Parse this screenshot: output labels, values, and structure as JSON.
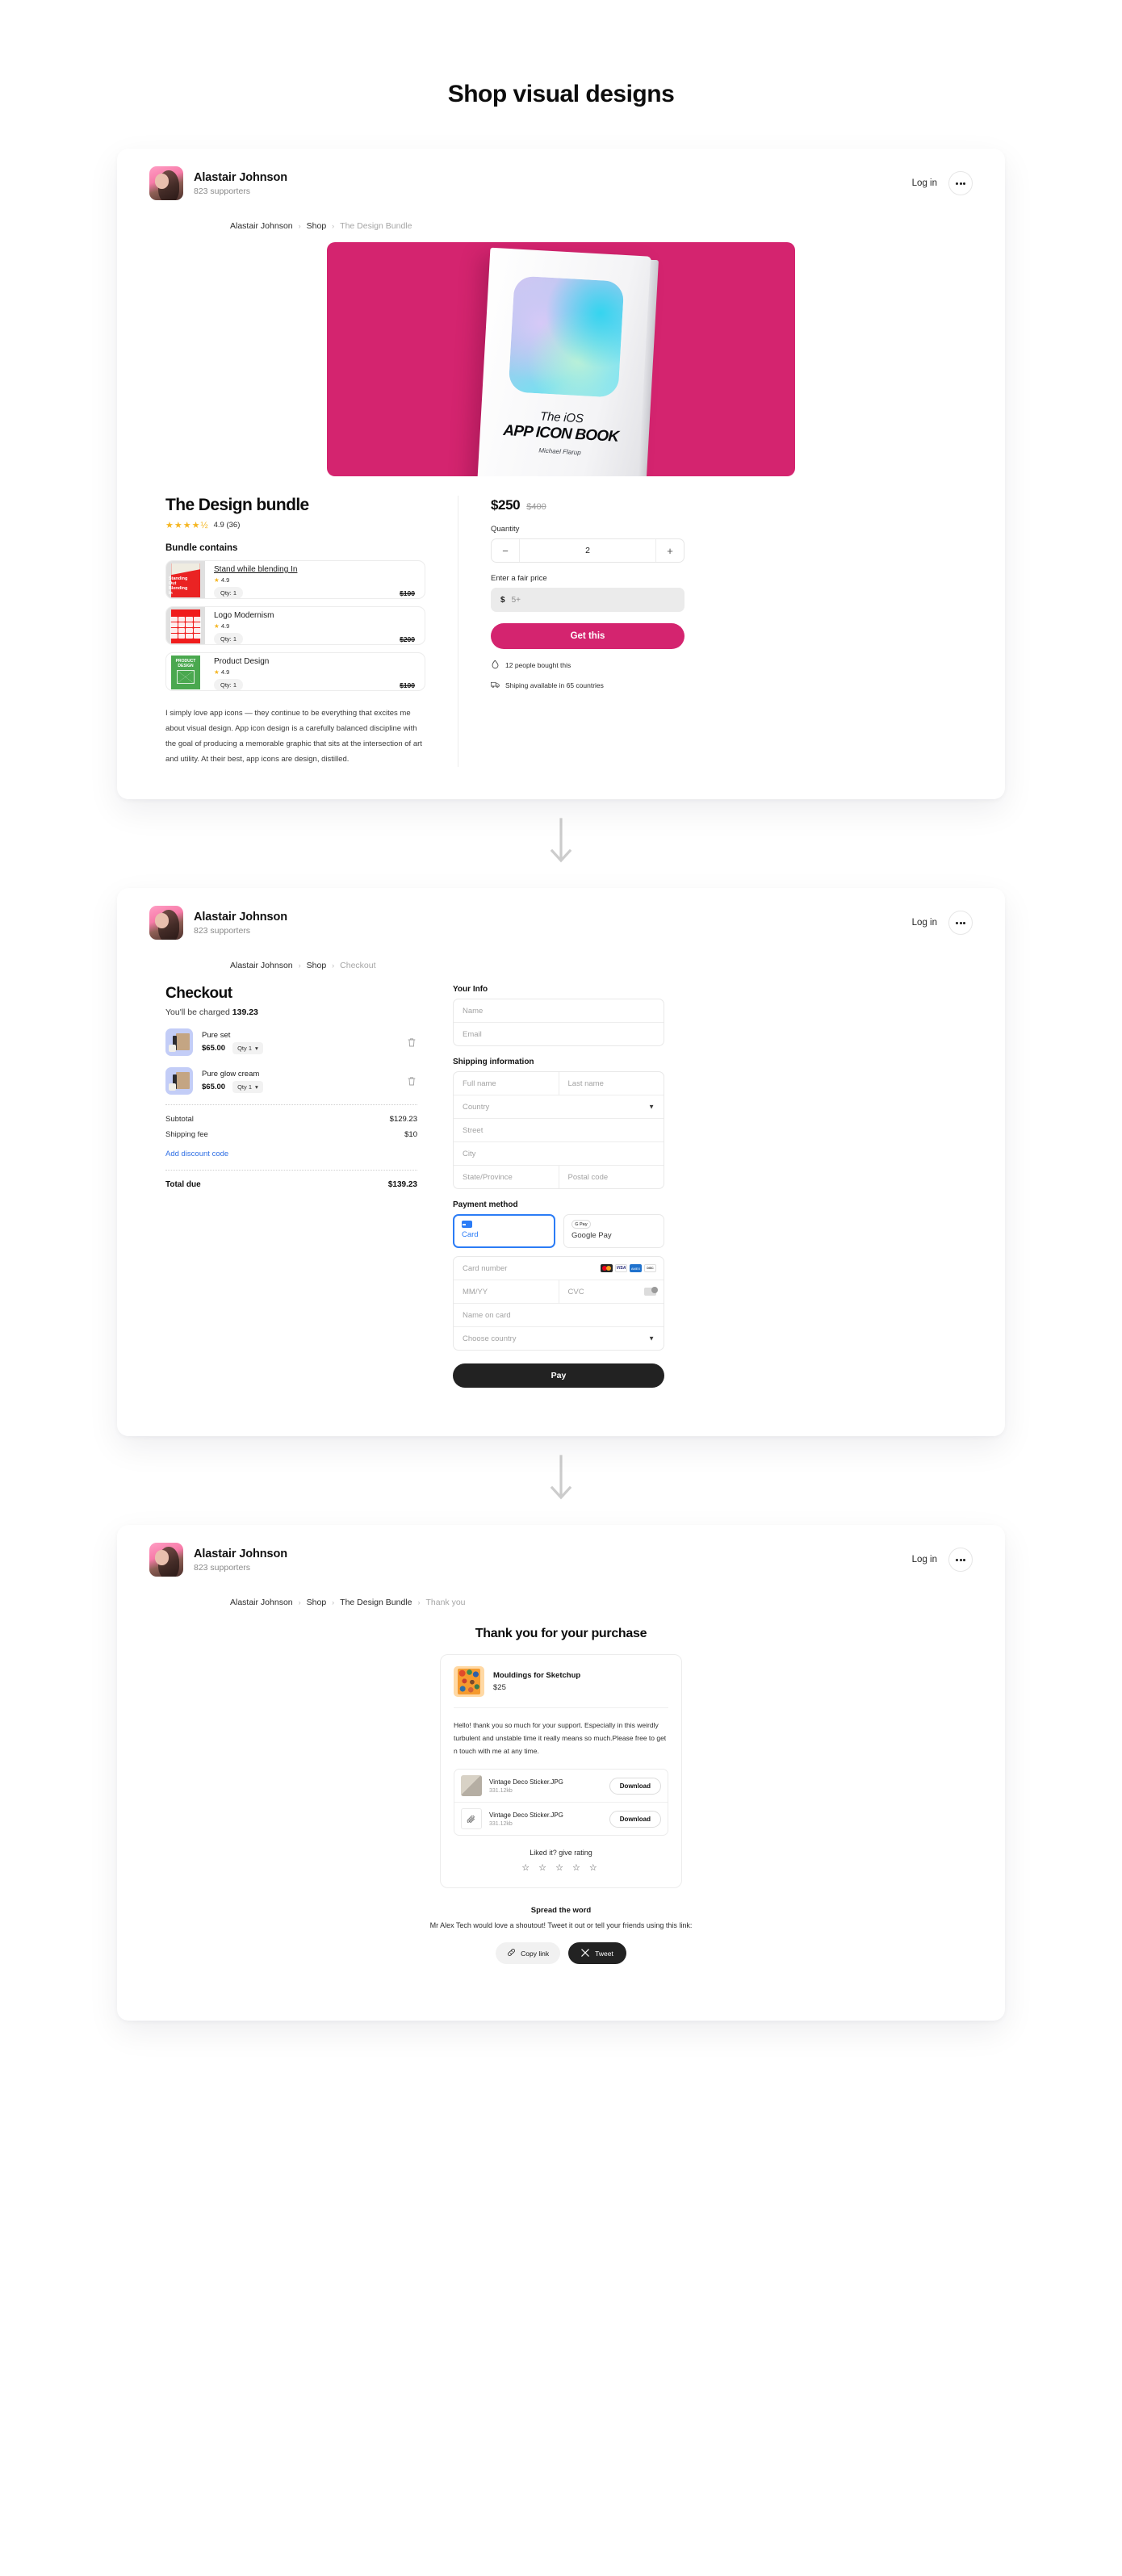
{
  "page": {
    "title": "Shop visual designs"
  },
  "colors": {
    "brand_pink": "#d4246f",
    "link_blue": "#2f6fe4",
    "dark": "#222222",
    "star_gold": "#f5b622"
  },
  "creator": {
    "name": "Alastair Johnson",
    "supporters": "823 supporters",
    "login_label": "Log in",
    "more_label": "•••"
  },
  "card1": {
    "breadcrumb": [
      {
        "label": "Alastair Johnson",
        "current": false
      },
      {
        "label": "Shop",
        "current": false
      },
      {
        "label": "The Design Bundle",
        "current": true
      }
    ],
    "hero": {
      "book_line1": "The iOS",
      "book_line2": "APP ICON BOOK",
      "book_author": "Michael Flarup"
    },
    "product": {
      "title": "The Design bundle",
      "stars": "★★★★½",
      "rating_text": "4.9 (36)",
      "bundle_label": "Bundle contains",
      "items": [
        {
          "name": "Stand while blending In",
          "rating": "4.9",
          "qty": "Qty: 1",
          "price": "$100",
          "thumb_label": "Standing\nOut\nBlending\nIn"
        },
        {
          "name": "Logo Modernism",
          "rating": "4.9",
          "qty": "Qty: 1",
          "price": "$200",
          "thumb_label": "LOGO MODERNISM"
        },
        {
          "name": "Product Design",
          "rating": "4.9",
          "qty": "Qty: 1",
          "price": "$100",
          "thumb_label": "PRODUCT DESIGN"
        }
      ],
      "description": "I simply love app icons — they continue to be everything that excites me about visual design. App icon design is a carefully balanced discipline with the goal of producing a memorable graphic that sits at the intersection of art and utility. At their best, app icons are design, distilled."
    },
    "purchase": {
      "price": "$250",
      "price_original": "$400",
      "quantity_label": "Quantity",
      "quantity_value": "2",
      "minus_label": "−",
      "plus_label": "+",
      "fair_price_label": "Enter a fair price",
      "fair_price_symbol": "$",
      "fair_price_placeholder": "5+",
      "cta_label": "Get this",
      "note_bought": "12 people bought this",
      "note_shipping": "Shiping available in 65 countries"
    }
  },
  "card2": {
    "breadcrumb": [
      {
        "label": "Alastair Johnson",
        "current": false
      },
      {
        "label": "Shop",
        "current": false
      },
      {
        "label": "Checkout",
        "current": true
      }
    ],
    "title": "Checkout",
    "charged_prefix": "You'll be charged ",
    "charged_amount": "139.23",
    "items": [
      {
        "name": "Pure set",
        "price": "$65.00",
        "qty": "Qty 1"
      },
      {
        "name": "Pure glow cream",
        "price": "$65.00",
        "qty": "Qty 1"
      }
    ],
    "lines": [
      {
        "label": "Subtotal",
        "value": "$129.23"
      },
      {
        "label": "Shipping fee",
        "value": "$10"
      }
    ],
    "discount_label": "Add discount code",
    "total_label": "Total due",
    "total_value": "$139.23",
    "form": {
      "your_info_label": "Your Info",
      "name_placeholder": "Name",
      "email_placeholder": "Email",
      "shipping_label": "Shipping information",
      "full_name_placeholder": "Full name",
      "last_name_placeholder": "Last name",
      "country_placeholder": "Country",
      "street_placeholder": "Street",
      "city_placeholder": "City",
      "state_placeholder": "State/Province",
      "postal_placeholder": "Postal code",
      "payment_label": "Payment method",
      "method_card": "Card",
      "method_gpay": "Google Pay",
      "gpay_badge": "G Pay",
      "card_number_placeholder": "Card number",
      "expiry_placeholder": "MM/YY",
      "cvc_placeholder": "CVC",
      "name_on_card_placeholder": "Name on card",
      "choose_country_placeholder": "Choose country",
      "pay_label": "Pay",
      "brands": [
        "mastercard",
        "visa",
        "amex",
        "discover"
      ]
    }
  },
  "card3": {
    "breadcrumb": [
      {
        "label": "Alastair Johnson",
        "current": false
      },
      {
        "label": "Shop",
        "current": false
      },
      {
        "label": "The Design Bundle",
        "current": false
      },
      {
        "label": "Thank you",
        "current": true
      }
    ],
    "title": "Thank you for your purchase",
    "product": {
      "name": "Mouldings for Sketchup",
      "price": "$25"
    },
    "message": "Hello! thank you so much for your support. Especially in this weirdly turbulent and unstable time it really means so much.Please free to get n touch with me at any time.",
    "downloads": [
      {
        "name": "Vintage Deco Sticker.JPG",
        "size": "331.12kb",
        "button": "Download"
      },
      {
        "name": "Vintage Deco Sticker.JPG",
        "size": "331.12kb",
        "button": "Download"
      }
    ],
    "rating_prompt": "Liked it? give rating",
    "rating_stars": "☆ ☆ ☆ ☆ ☆",
    "spread_title": "Spread the word",
    "spread_text": "Mr Alex Tech would love a shoutout! Tweet it out or tell your friends using this link:",
    "copy_label": "Copy link",
    "tweet_label": "Tweet",
    "tweet_icon": "𝕏"
  }
}
